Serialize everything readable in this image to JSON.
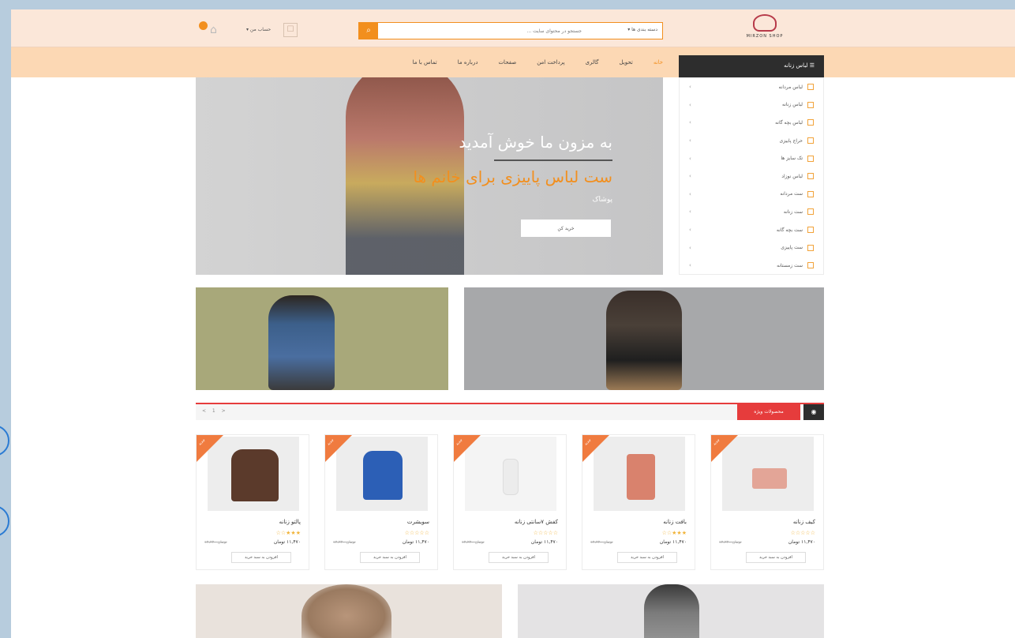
{
  "topbar": {
    "account_label": "حساب من",
    "search_placeholder": "جستجو در محتوای سایت ...",
    "search_category": "دسته بندی ها",
    "logo_text": "MIRZON SHOP",
    "cart_count": ""
  },
  "nav": {
    "items": [
      "خانه",
      "تحویل",
      "گالری",
      "پرداخت امن",
      "صفحات",
      "درباره ما",
      "تماس با ما"
    ]
  },
  "sidebar": {
    "title": "لباس زنانه",
    "items": [
      "لباس مردانه",
      "لباس زنانه",
      "لباس بچه گانه",
      "حراج پاییزی",
      "تک سایز ها",
      "لباس نوزاد",
      "ست مردانه",
      "ست زنانه",
      "ست بچه گانه",
      "ست پاییزی",
      "ست زمستانه"
    ]
  },
  "hero": {
    "title": "به مزون ما خوش آمدید",
    "subtitle": "ست لباس پاییزی برای خانم ها",
    "category": "پوشاک",
    "button": "خرید کن"
  },
  "specials": {
    "label": "محصولات ویژه",
    "pager": "< 1 >"
  },
  "products": [
    {
      "name": "کیف زنانه",
      "price": "۱۱,۴۷۰ تومان",
      "old_price": "۱۲,۲۲۰ تومان",
      "badge": "جدید",
      "button": "افزودن به سبد خرید",
      "stars": "☆☆☆☆☆"
    },
    {
      "name": "بافت زنانه",
      "price": "۱۱,۴۷۰ تومان",
      "old_price": "۱۲,۲۲۰ تومان",
      "badge": "جدید",
      "button": "افزودن به سبد خرید",
      "stars": "☆☆★★★"
    },
    {
      "name": "کفش ۷سانتی زنانه",
      "price": "۱۱,۴۷۰ تومان",
      "old_price": "۱۲,۲۲۰ تومان",
      "badge": "جدید",
      "button": "افزودن به سبد خرید",
      "stars": "☆☆☆☆☆"
    },
    {
      "name": "سویشرت",
      "price": "۱۱,۴۷۰ تومان",
      "old_price": "۱۲,۲۲۰ تومان",
      "badge": "جدید",
      "button": "افزودن به سبد خرید",
      "stars": "☆☆☆☆☆"
    },
    {
      "name": "پالتو زنانه",
      "price": "۱۱,۴۷۰ تومان",
      "old_price": "۱۲,۲۲۰ تومان",
      "badge": "جدید",
      "button": "افزودن به سبد خرید",
      "stars": "☆☆★★★"
    }
  ],
  "colors": {
    "accent": "#f28f1e",
    "nav_bg": "#fcd8b4",
    "special_red": "#e63c3c",
    "dark": "#2d2d2d"
  }
}
